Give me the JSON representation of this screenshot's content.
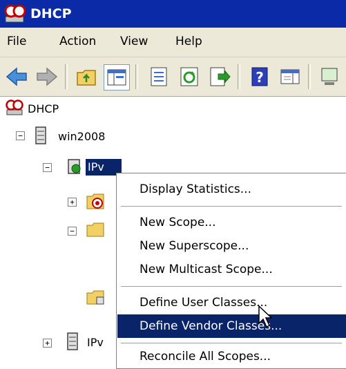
{
  "window": {
    "title": "DHCP"
  },
  "menubar": {
    "items": [
      "File",
      "Action",
      "View",
      "Help"
    ]
  },
  "tree": {
    "root": "DHCP",
    "server": "win2008",
    "ipv4_partial": "IPv",
    "ipv6_partial": "IPv"
  },
  "context_menu": {
    "items": [
      "Display Statistics...",
      "New Scope...",
      "New Superscope...",
      "New Multicast Scope...",
      "Define User Classes...",
      "Define Vendor Classes...",
      "Reconcile All Scopes..."
    ],
    "highlighted": "Define Vendor Classes..."
  },
  "colors": {
    "titlebar": "#0a2aa8",
    "highlight": "#0a246a",
    "chrome": "#ece9d8"
  }
}
